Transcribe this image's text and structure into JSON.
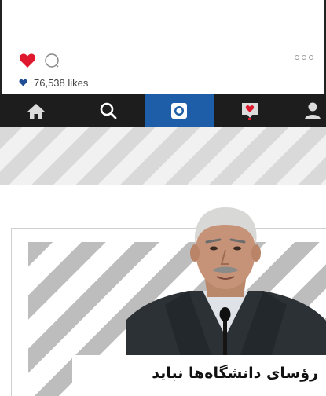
{
  "post": {
    "likes_text": "76,538 likes",
    "like_color": "#e0182d",
    "small_heart_color": "#1f4e96"
  },
  "nav": {
    "active_color": "#1e5ea8",
    "bar_color": "#1d1d1d",
    "tabs": [
      {
        "name": "home-icon"
      },
      {
        "name": "search-icon"
      },
      {
        "name": "camera-icon"
      },
      {
        "name": "activity-heart-icon"
      },
      {
        "name": "profile-icon"
      }
    ]
  },
  "article": {
    "headline": "رؤسای دانشگاه‌ها نباید"
  }
}
